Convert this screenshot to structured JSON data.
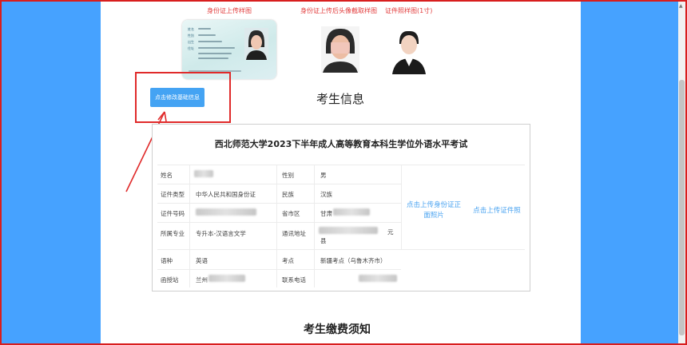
{
  "samples": {
    "id_card_sample": "身份证上传样图",
    "id_crop_sample": "身份证上传后头像截取样图",
    "photo_sample": "证件照样图(1寸)"
  },
  "edit_button": "点击修改基础信息",
  "section_title": "考生信息",
  "exam_title": "西北师范大学2023下半年成人高等教育本科生学位外语水平考试",
  "fields": {
    "name_label": "姓名",
    "gender_label": "性别",
    "gender_value": "男",
    "id_type_label": "证件类型",
    "id_type_value": "中华人民共和国身份证",
    "ethnicity_label": "民族",
    "ethnicity_value": "汉族",
    "id_number_label": "证件号码",
    "province_label": "省市区",
    "province_value": "甘肃",
    "major_label": "所属专业",
    "major_value": "专升本-汉语言文学",
    "address_label": "通讯地址",
    "address_value_1": "元",
    "address_value_2": "县",
    "language_label": "语种",
    "language_value": "英语",
    "exam_site_label": "考点",
    "exam_site_value": "新疆考点（乌鲁木齐市）",
    "station_label": "函授站",
    "station_value": "兰州",
    "phone_label": "联系电话"
  },
  "upload_id_photo": "点击上传身份证正面照片",
  "upload_cert_photo": "点击上传证件照",
  "fee_title": "考生缴费须知",
  "colors": {
    "sidebar": "#46a2ff",
    "accent": "#44a3f3",
    "annotation": "#e02a2a"
  }
}
